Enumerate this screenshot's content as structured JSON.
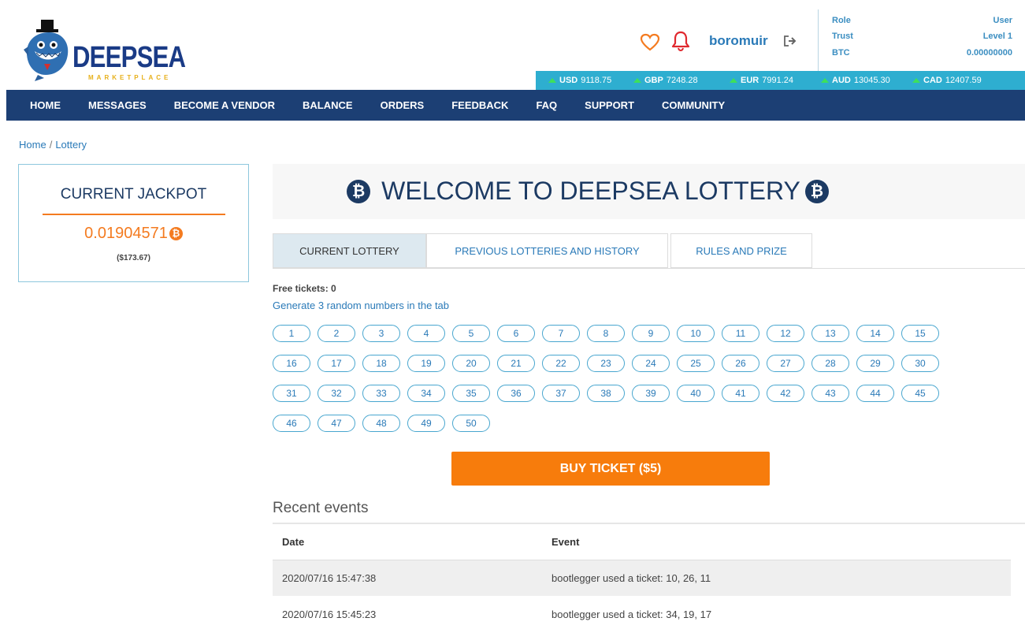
{
  "header": {
    "logo_text": "DEEPSEA",
    "logo_sub": "MARKETPLACE",
    "username": "boromuir",
    "info": [
      {
        "label": "Role",
        "value": "User"
      },
      {
        "label": "Trust",
        "value": "Level 1"
      },
      {
        "label": "BTC",
        "value": "0.00000000"
      }
    ],
    "rates": [
      {
        "currency": "USD",
        "value": "9118.75"
      },
      {
        "currency": "GBP",
        "value": "7248.28"
      },
      {
        "currency": "EUR",
        "value": "7991.24"
      },
      {
        "currency": "AUD",
        "value": "13045.30"
      },
      {
        "currency": "CAD",
        "value": "12407.59"
      }
    ],
    "accent_color": "#f47b20",
    "ticker_color": "#2eaed0"
  },
  "nav": {
    "items": [
      "HOME",
      "MESSAGES",
      "BECOME A VENDOR",
      "BALANCE",
      "ORDERS",
      "FEEDBACK",
      "FAQ",
      "SUPPORT",
      "COMMUNITY"
    ],
    "bg_color": "#1c3f74"
  },
  "breadcrumb": {
    "home": "Home",
    "current": "Lottery"
  },
  "jackpot": {
    "title": "CURRENT JACKPOT",
    "amount": "0.01904571",
    "usd": "($173.67)"
  },
  "main": {
    "welcome_title": "WELCOME TO DEEPSEA LOTTERY",
    "tabs": [
      {
        "label": "CURRENT LOTTERY",
        "active": true
      },
      {
        "label": "PREVIOUS LOTTERIES AND HISTORY",
        "active": false
      },
      {
        "label": "RULES AND PRIZE",
        "active": false
      }
    ],
    "free_tickets": "Free tickets: 0",
    "generate_hint": "Generate 3 random numbers in the tab",
    "numbers": [
      "1",
      "2",
      "3",
      "4",
      "5",
      "6",
      "7",
      "8",
      "9",
      "10",
      "11",
      "12",
      "13",
      "14",
      "15",
      "16",
      "17",
      "18",
      "19",
      "20",
      "21",
      "22",
      "23",
      "24",
      "25",
      "26",
      "27",
      "28",
      "29",
      "30",
      "31",
      "32",
      "33",
      "34",
      "35",
      "36",
      "37",
      "38",
      "39",
      "40",
      "41",
      "42",
      "43",
      "44",
      "45",
      "46",
      "47",
      "48",
      "49",
      "50"
    ],
    "buy_button": "BUY TICKET ($5)",
    "buy_color": "#f77c0c"
  },
  "recent": {
    "title": "Recent events",
    "columns": [
      "Date",
      "Event"
    ],
    "rows": [
      {
        "date": "2020/07/16 15:47:38",
        "event": "bootlegger used a ticket: 10, 26, 11"
      },
      {
        "date": "2020/07/16 15:45:23",
        "event": "bootlegger used a ticket: 34, 19, 17"
      }
    ]
  }
}
